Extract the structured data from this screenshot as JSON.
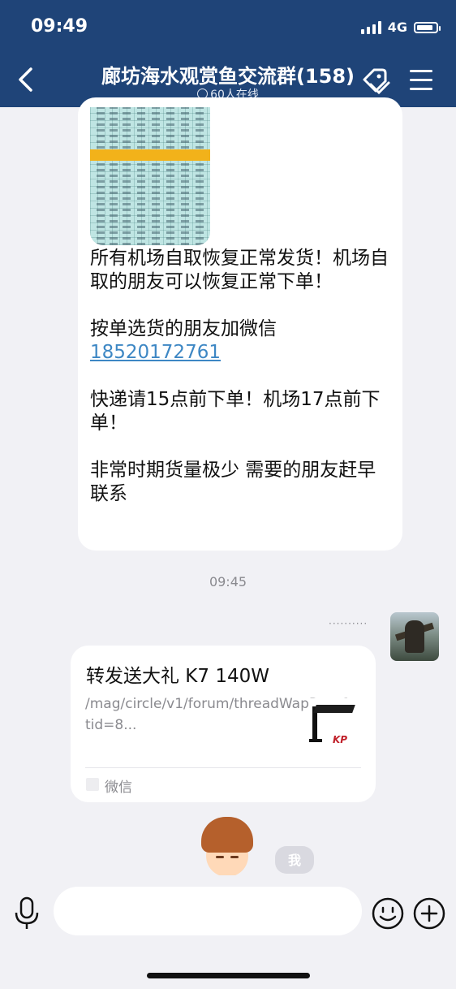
{
  "status_bar": {
    "time": "09:49",
    "network": "4G",
    "battery_percent": 80
  },
  "header": {
    "title": "廊坊海水观赏鱼交流群(158)",
    "subtitle": "60人在线",
    "back_icon": "chevron-left-icon",
    "tag_icon": "tag-icon",
    "menu_icon": "menu-icon"
  },
  "message1": {
    "text": "所有机场自取恢复正常发货！机场自取的朋友可以恢复正常下单！\n\n按单选货的朋友加微信",
    "phone": "18520172761",
    "text_after": "\n\n快递请15点前下单！机场17点前下单！\n\n非常时期货量极少 需要的朋友赶早联系"
  },
  "time_divider": "09:45",
  "link_card": {
    "title": "转发送大礼 K7 140W",
    "description": "/mag/circle/v1/forum/threadWapPage?tid=8...",
    "source": "微信",
    "thumb_logo": "KP"
  },
  "me_tag": "我",
  "input_bar": {
    "mic_icon": "microphone-icon",
    "emoji_icon": "emoji-icon",
    "plus_icon": "plus-icon"
  },
  "colors": {
    "header_bg": "#1f4478",
    "link": "#3d87c4",
    "page_bg": "#f1f1f5"
  }
}
